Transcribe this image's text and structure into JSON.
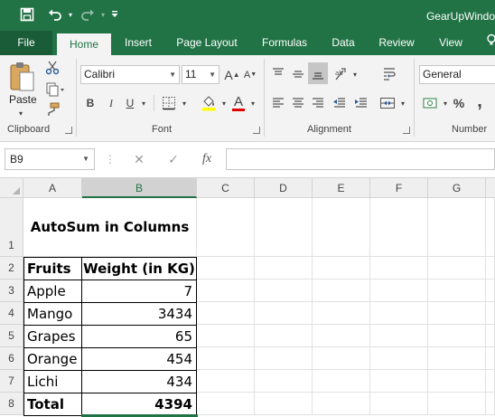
{
  "title_bar": {
    "doc_title": "GearUpWindo"
  },
  "tabs": [
    "File",
    "Home",
    "Insert",
    "Page Layout",
    "Formulas",
    "Data",
    "Review",
    "View"
  ],
  "ribbon": {
    "clipboard": {
      "paste_label": "Paste",
      "group_label": "Clipboard"
    },
    "font": {
      "font_name": "Calibri",
      "font_size": "11",
      "bold": "B",
      "italic": "I",
      "underline": "U",
      "font_color_glyph": "A",
      "grow_font": "A",
      "shrink_font": "A",
      "group_label": "Font"
    },
    "alignment": {
      "group_label": "Alignment"
    },
    "number": {
      "format": "General",
      "percent": "%",
      "comma": ",",
      "group_label": "Number"
    }
  },
  "formula_bar": {
    "name_box": "B9",
    "fx_label": "fx",
    "value": ""
  },
  "columns": [
    "A",
    "B",
    "C",
    "D",
    "E",
    "F",
    "G"
  ],
  "selected_column": "B",
  "rows": [
    "1",
    "2",
    "3",
    "4",
    "5",
    "6",
    "7",
    "8"
  ],
  "sheet": {
    "heading": "AutoSum in Columns",
    "table_header": {
      "fruit": "Fruits",
      "weight": "Weight (in KG)"
    },
    "items": [
      {
        "fruit": "Apple",
        "weight": "7"
      },
      {
        "fruit": "Mango",
        "weight": "3434"
      },
      {
        "fruit": "Grapes",
        "weight": "65"
      },
      {
        "fruit": "Orange",
        "weight": "454"
      },
      {
        "fruit": "Lichi",
        "weight": "434"
      }
    ],
    "total": {
      "label": "Total",
      "value": "4394"
    }
  },
  "colors": {
    "excel_green": "#217346",
    "ribbon_bg": "#f3f3f3",
    "header_bg": "#efefef"
  }
}
